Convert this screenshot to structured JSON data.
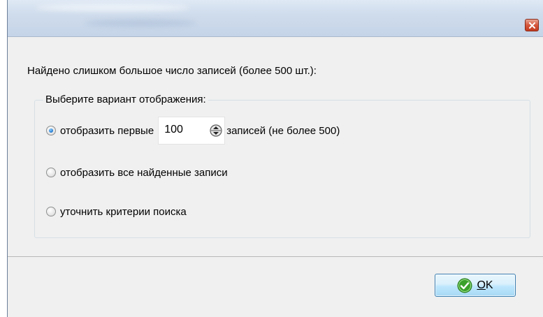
{
  "dialog": {
    "message": "Найдено слишком большое число записей (более 500 шт.):",
    "group_label": "Выберите вариант отображения:",
    "options": [
      {
        "label": "отобразить первые",
        "checked": true
      },
      {
        "label": "отобразить все найденные записи",
        "checked": false
      },
      {
        "label": "уточнить критерии поиска",
        "checked": false
      }
    ],
    "first_count_value": "100",
    "first_suffix": "записей (не более 500)",
    "ok_mnemonic": "O",
    "ok_rest": "K"
  },
  "icons": {
    "close": "close-icon",
    "ok": "check-circle-icon",
    "spin": "spin-arrows-icon"
  },
  "colors": {
    "accent": "#2a7fd3",
    "close_button": "#c23b20",
    "ok_check": "#3aa12b"
  }
}
